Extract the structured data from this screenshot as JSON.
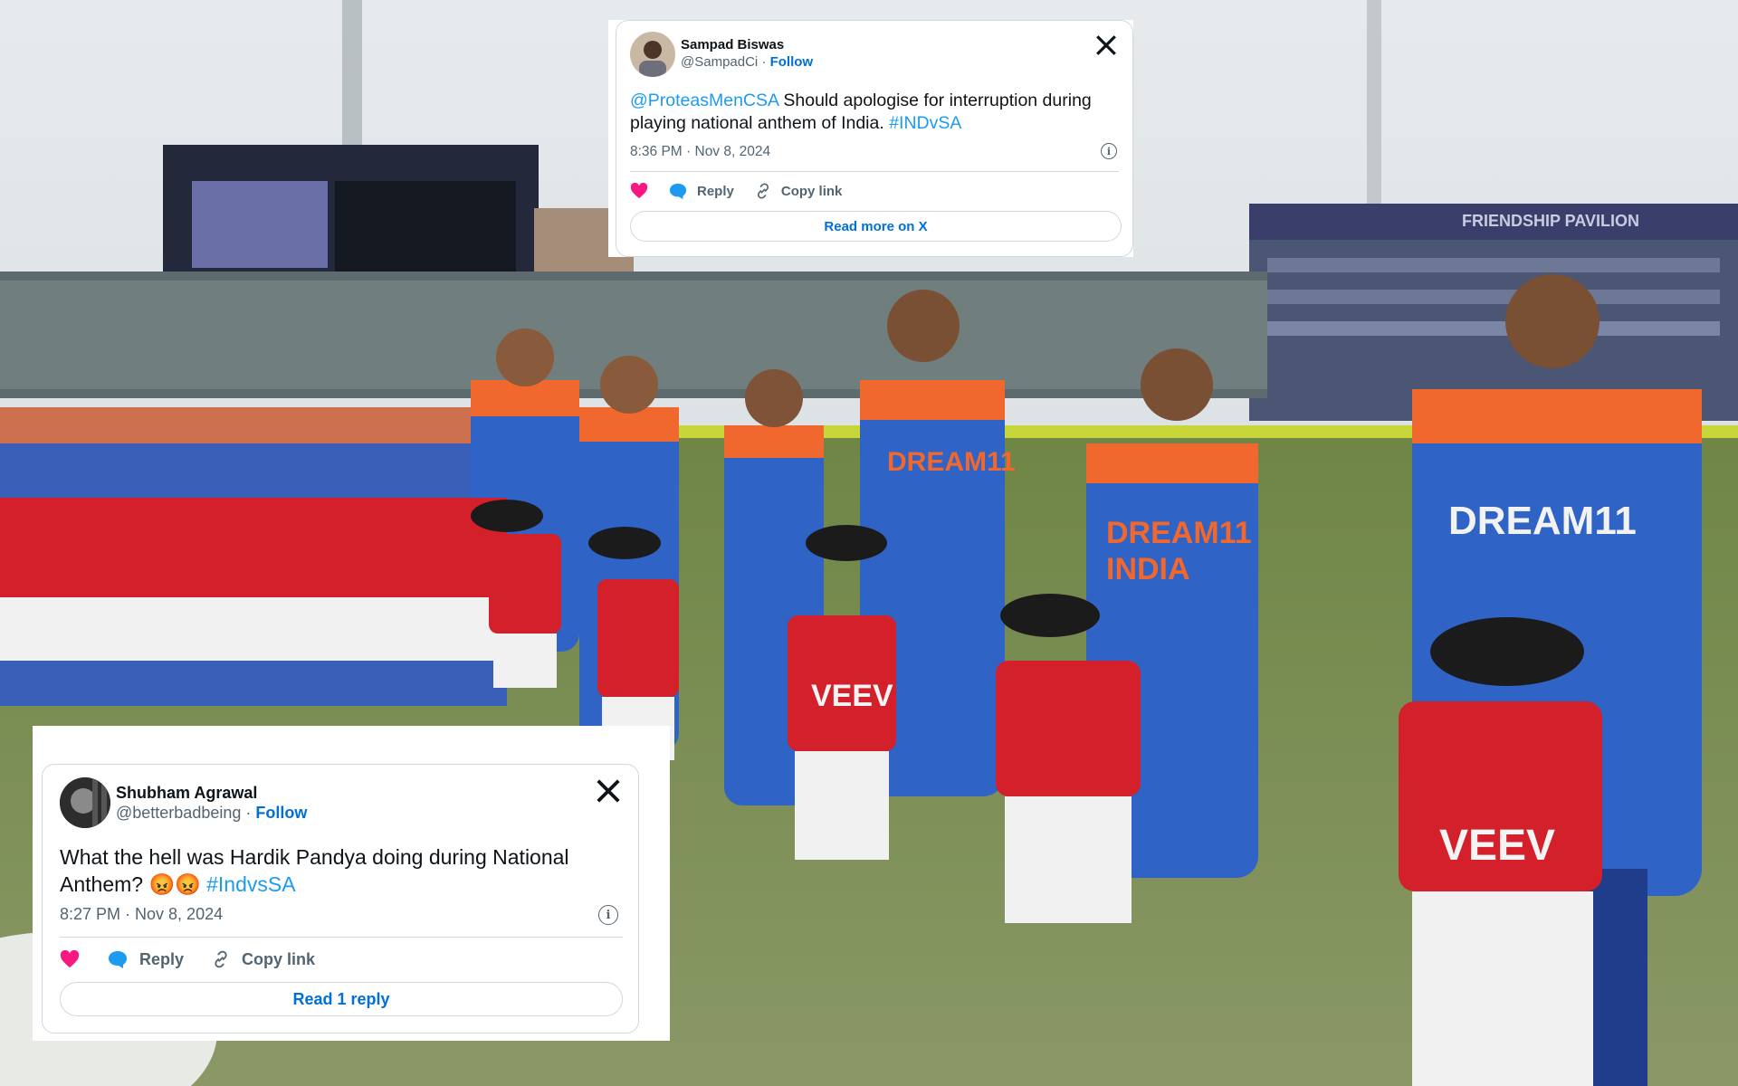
{
  "scene": {
    "pavilion_sign": "FRIENDSHIP PAVILION",
    "jersey_texts": [
      "DREAM11",
      "INDIA"
    ],
    "kid_shirt_text": "VEEV",
    "colors": {
      "grass": "#7d8f56",
      "jersey_blue": "#2f63c6",
      "jersey_orange": "#f0682d",
      "kid_red": "#d3202a"
    }
  },
  "tweets": [
    {
      "id": "top",
      "name": "Sampad Biswas",
      "handle": "@SampadCi",
      "separator": "·",
      "follow": "Follow",
      "text_mention": "@ProteasMenCSA",
      "text_main": " Should apologise for interruption during playing national anthem of India. ",
      "text_hashtag": "#INDvSA",
      "time": "8:36 PM · Nov 8, 2024",
      "reply": "Reply",
      "copy": "Copy link",
      "cta": "Read more on X"
    },
    {
      "id": "bottom",
      "name": "Shubham Agrawal",
      "handle": "@betterbadbeing",
      "separator": "·",
      "follow": "Follow",
      "text_main": "What the hell was Hardik Pandya doing during National Anthem? 😡😡 ",
      "text_hashtag": "#IndvsSA",
      "time": "8:27 PM · Nov 8, 2024",
      "reply": "Reply",
      "copy": "Copy link",
      "cta": "Read 1 reply"
    }
  ],
  "icons": [
    "x-logo-icon",
    "heart-icon",
    "reply-bubble-icon",
    "link-icon",
    "info-icon"
  ]
}
